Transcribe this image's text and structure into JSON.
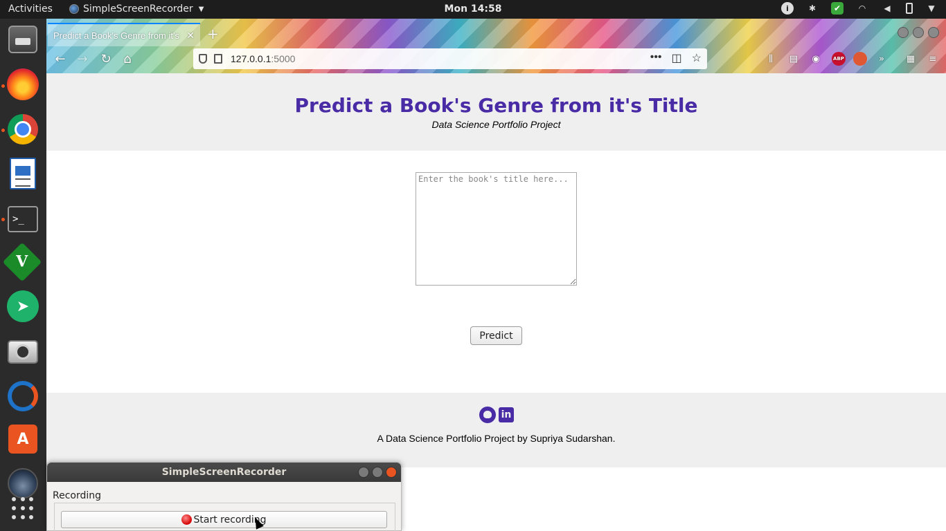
{
  "topbar": {
    "activities": "Activities",
    "app_name": "SimpleScreenRecorder",
    "clock": "Mon 14:58"
  },
  "dock": {
    "items": [
      "files",
      "firefox",
      "chrome",
      "libreoffice-writer",
      "terminal",
      "vim",
      "telegram",
      "screenshot",
      "ubuntu-software-updater",
      "ubuntu-software",
      "simplescreenrecorder",
      "show-applications"
    ]
  },
  "browser": {
    "tab_title": "Predict a Book's Genre from it's Title",
    "tab_close": "✕",
    "new_tab": "+",
    "url_host": "127.0.0.1",
    "url_port": ":5000"
  },
  "page": {
    "title": "Predict a Book's Genre from it's Title",
    "subtitle": "Data Science Portfolio Project",
    "input_placeholder": "Enter the book's title here...",
    "predict_label": "Predict",
    "footer_text": "A Data Science Portfolio Project by Supriya Sudarshan."
  },
  "recorder": {
    "window_title": "SimpleScreenRecorder",
    "group_label": "Recording",
    "start_label": "Start recording"
  },
  "colors": {
    "title_purple": "#4a2ba6",
    "header_bg": "#efefef",
    "ubuntu_orange": "#e95420"
  }
}
